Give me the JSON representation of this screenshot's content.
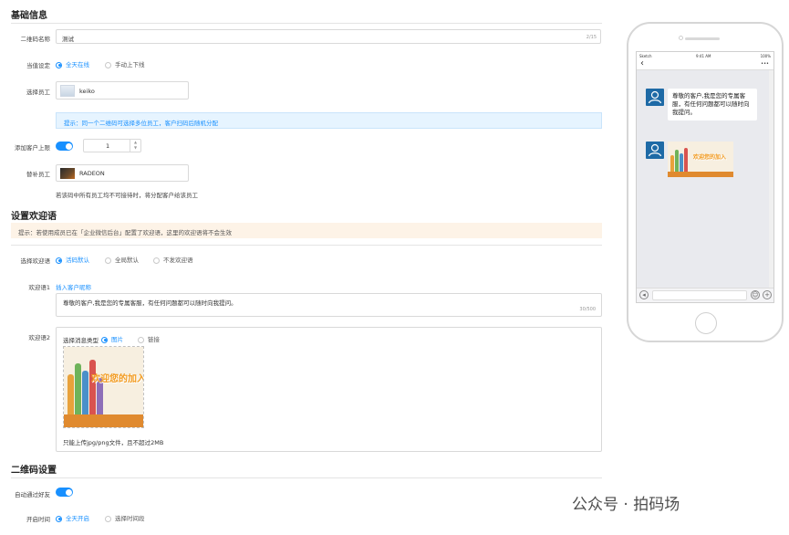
{
  "sections": {
    "basic": "基础信息",
    "welcome": "设置欢迎语",
    "qr": "二维码设置"
  },
  "basic": {
    "qr_name_label": "二维码名称",
    "qr_name_value": "测试",
    "qr_name_count": "2/15",
    "status_label": "当值设定",
    "status_opt1": "全天在线",
    "status_opt2": "手动上下线",
    "staff_label": "选择员工",
    "staff_value": "keiko",
    "staff_tip": "提示：同一个二维码可选择多位员工，客户扫码后随机分配",
    "limit_label": "添加客户上限",
    "limit_value": "1",
    "backup_label": "替补员工",
    "backup_value": "RADEON",
    "backup_tip": "若该码中所有员工均不可接待时，将分配客户给该员工"
  },
  "welcome": {
    "notice": "提示：若使用成员已在「企业微信后台」配置了欢迎语，这里的欢迎语将不会生效",
    "select_label": "选择欢迎语",
    "opt1": "活码默认",
    "opt2": "全局默认",
    "opt3": "不发欢迎语",
    "msg1_label": "欢迎语1",
    "insert_nickname": "插入客户昵称",
    "msg1_text": "尊敬的客户,我是您的专属客服，有任何问题都可以随时向我提问。",
    "msg1_count": "30/500",
    "msg2_label": "欢迎语2",
    "msg_type_label": "选择消息类型",
    "type_image": "图片",
    "type_link": "链接",
    "image_caption": "欢迎您的加入",
    "upload_tip": "只能上传jpg/png文件，且不超过2MB"
  },
  "qr": {
    "auto_label": "自动通过好友",
    "time_label": "开启时间",
    "time_opt1": "全天开启",
    "time_opt2": "选择时间段"
  },
  "phone": {
    "carrier": "Sketch",
    "time": "9:41 AM",
    "battery": "100%",
    "back_icon": "‹",
    "more_icon": "•••",
    "bubble_text": "尊敬的客户,我是您的专属客服，有任何问题都可以随时向我提问。",
    "image_caption": "欢迎您的加入"
  },
  "watermark": "公众号 · 拍码场",
  "colors": {
    "accent": "#1890ff",
    "tip_bg": "#e6f4ff",
    "notice_bg": "#fdf3e7",
    "avatar": "#1e6aa6"
  }
}
